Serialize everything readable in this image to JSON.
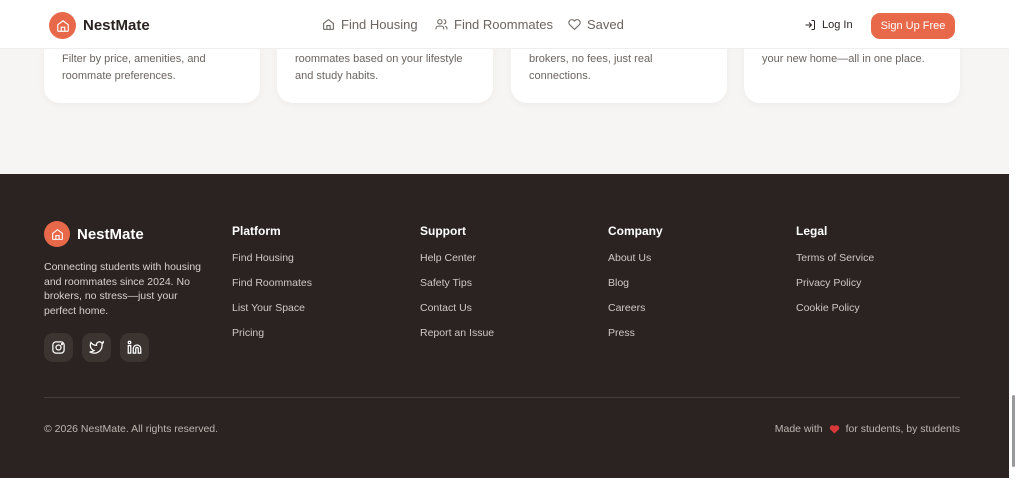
{
  "header": {
    "brand": "NestMate",
    "nav": [
      {
        "label": "Find Housing",
        "icon": "home-icon"
      },
      {
        "label": "Find Roommates",
        "icon": "users-icon"
      },
      {
        "label": "Saved",
        "icon": "heart-icon"
      }
    ],
    "login": "Log In",
    "signup": "Sign Up Free"
  },
  "cards": [
    "Filter by price, amenities, and roommate preferences.",
    "roommates based on your lifestyle and study habits.",
    "brokers, no fees, just real connections.",
    "your new home—all in one place."
  ],
  "footer": {
    "brand": "NestMate",
    "description": "Connecting students with housing and roommates since 2024. No brokers, no stress—just your perfect home.",
    "columns": [
      {
        "title": "Platform",
        "links": [
          "Find Housing",
          "Find Roommates",
          "List Your Space",
          "Pricing"
        ]
      },
      {
        "title": "Support",
        "links": [
          "Help Center",
          "Safety Tips",
          "Contact Us",
          "Report an Issue"
        ]
      },
      {
        "title": "Company",
        "links": [
          "About Us",
          "Blog",
          "Careers",
          "Press"
        ]
      },
      {
        "title": "Legal",
        "links": [
          "Terms of Service",
          "Privacy Policy",
          "Cookie Policy"
        ]
      }
    ],
    "copyright": "© 2026 NestMate. All rights reserved.",
    "made_pre": "Made with",
    "made_post": "for students, by students"
  },
  "colors": {
    "accent": "#e8694a",
    "footer": "#2a2321",
    "heart": "#d9383a"
  }
}
